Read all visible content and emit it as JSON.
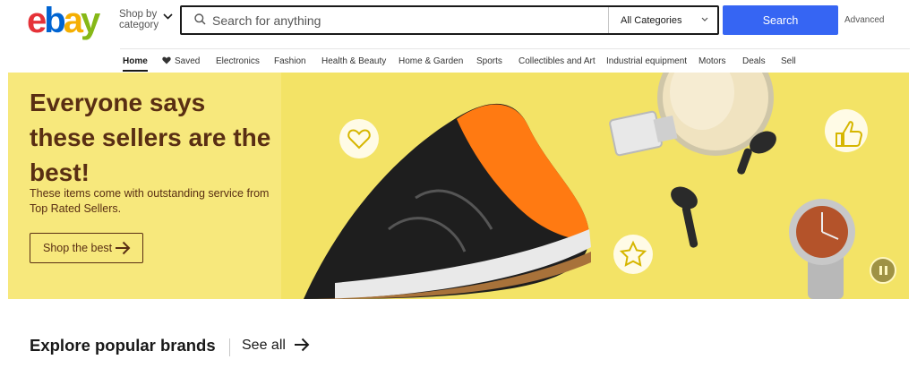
{
  "header": {
    "logo": "ebay",
    "shop_by_category": "Shop by category",
    "search_placeholder": "Search for anything",
    "category_select": "All Categories",
    "search_button": "Search",
    "advanced_link": "Advanced"
  },
  "nav": {
    "items": [
      "Home",
      "Saved",
      "Electronics",
      "Fashion",
      "Health & Beauty",
      "Home & Garden",
      "Sports",
      "Collectibles and Art",
      "Industrial equipment",
      "Motors",
      "Deals",
      "Sell"
    ],
    "active": "Home"
  },
  "hero": {
    "title": "Everyone says these sellers are the best!",
    "subtitle": "These items come with outstanding service from Top Rated Sellers.",
    "cta_label": "Shop the best"
  },
  "brands": {
    "title": "Explore popular brands",
    "see_all": "See all"
  },
  "icons": [
    "search-icon",
    "chevron-down-icon",
    "heart-icon",
    "arrow-right-icon",
    "thumbs-up-icon",
    "star-icon",
    "pause-icon"
  ],
  "colors": {
    "brand_blue": "#3665f3",
    "hero_bg": "#f7e87c",
    "hero_text": "#592e13",
    "logo_red": "#e53238",
    "logo_blue": "#0064d2",
    "logo_yellow": "#f5af02",
    "logo_green": "#86b817"
  }
}
